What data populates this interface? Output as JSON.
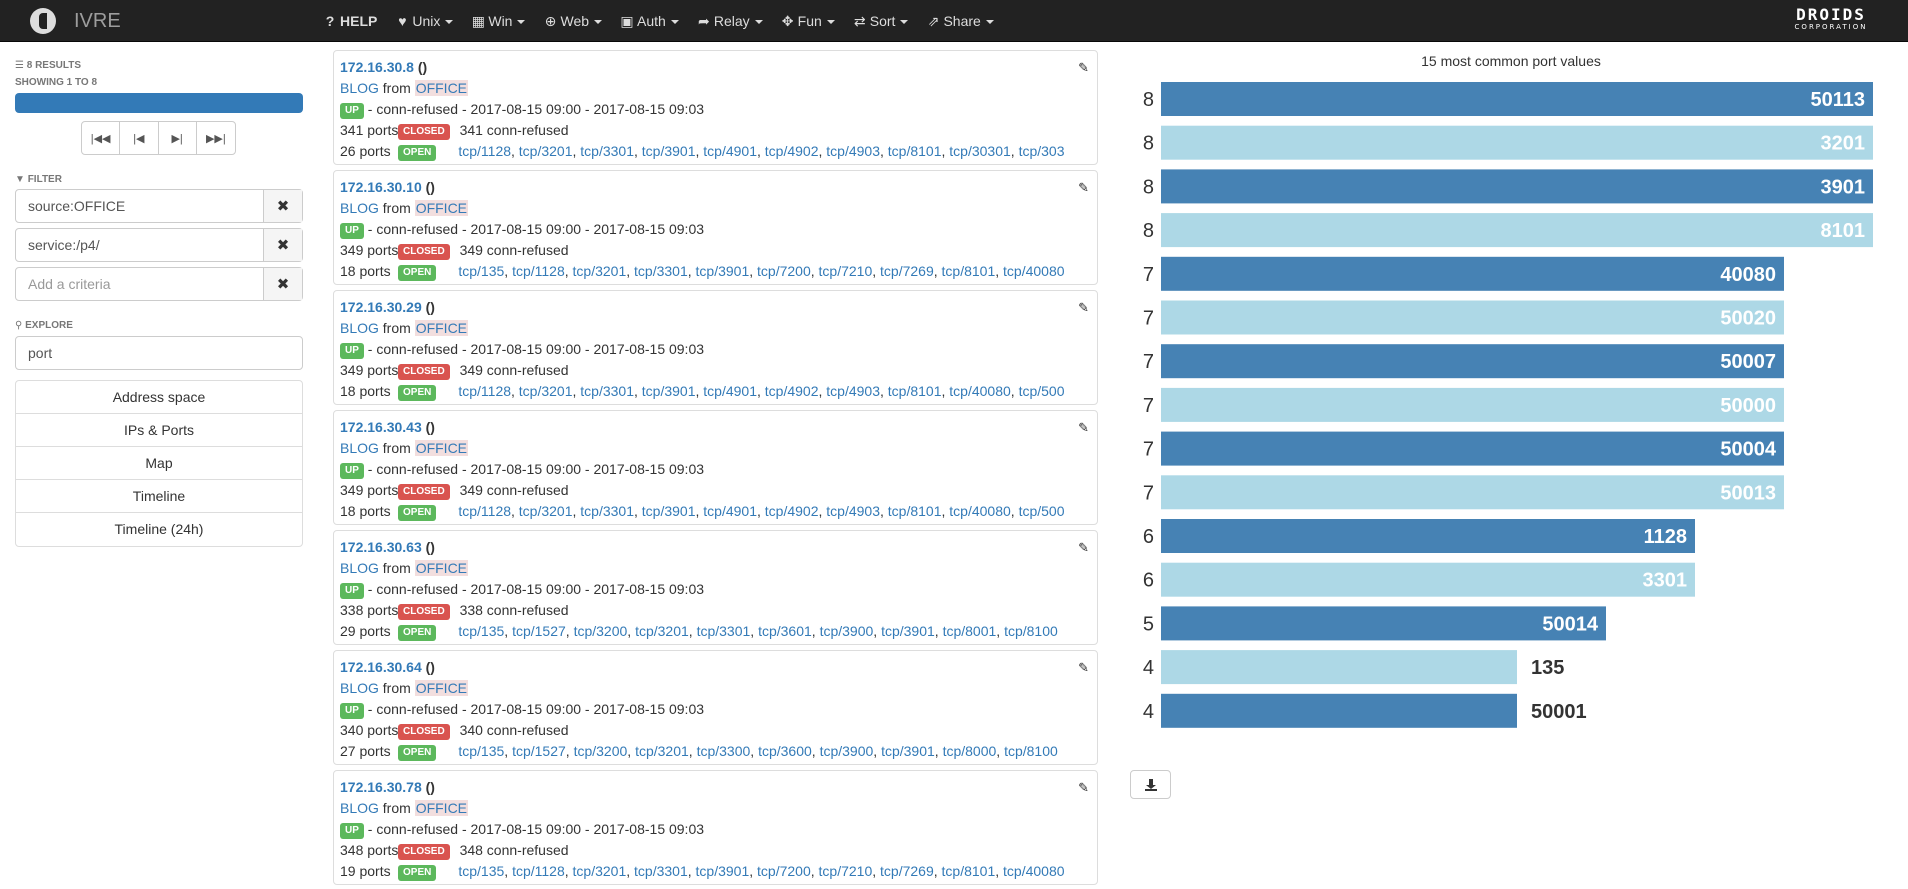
{
  "nav": {
    "brand": "IVRE",
    "items": [
      {
        "icon": "question-circle-icon",
        "glyph": "?",
        "label": "HELP",
        "bold": true,
        "caret": false
      },
      {
        "icon": "heart-icon",
        "glyph": "♥",
        "label": "Unix",
        "caret": true
      },
      {
        "icon": "windows-icon",
        "glyph": "▦",
        "label": "Win",
        "caret": true
      },
      {
        "icon": "globe-icon",
        "glyph": "⊕",
        "label": "Web",
        "caret": true
      },
      {
        "icon": "lock-icon",
        "glyph": "▣",
        "label": "Auth",
        "caret": true
      },
      {
        "icon": "share-arrow-icon",
        "glyph": "➦",
        "label": "Relay",
        "caret": true
      },
      {
        "icon": "move-icon",
        "glyph": "✥",
        "label": "Fun",
        "caret": true
      },
      {
        "icon": "random-icon",
        "glyph": "⇄",
        "label": "Sort",
        "caret": true
      },
      {
        "icon": "external-link-icon",
        "glyph": "⇗",
        "label": "Share",
        "caret": true
      }
    ],
    "corp_line1": "DROIDS",
    "corp_line2": "CORPORATION"
  },
  "sidebar": {
    "results_label": "8 RESULTS",
    "showing_label": "SHOWING 1 TO 8",
    "progress": 1.0,
    "filter_label": "FILTER",
    "criteria": [
      "source:OFFICE",
      "service:/p4/"
    ],
    "add_placeholder": "Add a criteria",
    "explore_label": "EXPLORE",
    "explore_value": "port",
    "explore_items": [
      "Address space",
      "IPs & Ports",
      "Map",
      "Timeline",
      "Timeline (24h)"
    ]
  },
  "hosts": [
    {
      "ip": "172.16.30.8",
      "paren": "()",
      "source": "BLOG",
      "from": "from",
      "category": "OFFICE",
      "up": "UP",
      "status_text": "- conn-refused - 2017-08-15 09:00 - 2017-08-15 09:03",
      "closed_count": "341 ports",
      "closed_label": "CLOSED",
      "closed_reason": "341 conn-refused",
      "open_count": "26 ports",
      "open_label": "OPEN",
      "ports": [
        "tcp/1128",
        "tcp/3201",
        "tcp/3301",
        "tcp/3901",
        "tcp/4901",
        "tcp/4902",
        "tcp/4903",
        "tcp/8101",
        "tcp/30301",
        "tcp/303"
      ]
    },
    {
      "ip": "172.16.30.10",
      "paren": "()",
      "source": "BLOG",
      "from": "from",
      "category": "OFFICE",
      "up": "UP",
      "status_text": "- conn-refused - 2017-08-15 09:00 - 2017-08-15 09:03",
      "closed_count": "349 ports",
      "closed_label": "CLOSED",
      "closed_reason": "349 conn-refused",
      "open_count": "18 ports",
      "open_label": "OPEN",
      "ports": [
        "tcp/135",
        "tcp/1128",
        "tcp/3201",
        "tcp/3301",
        "tcp/3901",
        "tcp/7200",
        "tcp/7210",
        "tcp/7269",
        "tcp/8101",
        "tcp/40080"
      ]
    },
    {
      "ip": "172.16.30.29",
      "paren": "()",
      "source": "BLOG",
      "from": "from",
      "category": "OFFICE",
      "up": "UP",
      "status_text": "- conn-refused - 2017-08-15 09:00 - 2017-08-15 09:03",
      "closed_count": "349 ports",
      "closed_label": "CLOSED",
      "closed_reason": "349 conn-refused",
      "open_count": "18 ports",
      "open_label": "OPEN",
      "ports": [
        "tcp/1128",
        "tcp/3201",
        "tcp/3301",
        "tcp/3901",
        "tcp/4901",
        "tcp/4902",
        "tcp/4903",
        "tcp/8101",
        "tcp/40080",
        "tcp/500"
      ]
    },
    {
      "ip": "172.16.30.43",
      "paren": "()",
      "source": "BLOG",
      "from": "from",
      "category": "OFFICE",
      "up": "UP",
      "status_text": "- conn-refused - 2017-08-15 09:00 - 2017-08-15 09:03",
      "closed_count": "349 ports",
      "closed_label": "CLOSED",
      "closed_reason": "349 conn-refused",
      "open_count": "18 ports",
      "open_label": "OPEN",
      "ports": [
        "tcp/1128",
        "tcp/3201",
        "tcp/3301",
        "tcp/3901",
        "tcp/4901",
        "tcp/4902",
        "tcp/4903",
        "tcp/8101",
        "tcp/40080",
        "tcp/500"
      ]
    },
    {
      "ip": "172.16.30.63",
      "paren": "()",
      "source": "BLOG",
      "from": "from",
      "category": "OFFICE",
      "up": "UP",
      "status_text": "- conn-refused - 2017-08-15 09:00 - 2017-08-15 09:03",
      "closed_count": "338 ports",
      "closed_label": "CLOSED",
      "closed_reason": "338 conn-refused",
      "open_count": "29 ports",
      "open_label": "OPEN",
      "ports": [
        "tcp/135",
        "tcp/1527",
        "tcp/3200",
        "tcp/3201",
        "tcp/3301",
        "tcp/3601",
        "tcp/3900",
        "tcp/3901",
        "tcp/8001",
        "tcp/8100"
      ]
    },
    {
      "ip": "172.16.30.64",
      "paren": "()",
      "source": "BLOG",
      "from": "from",
      "category": "OFFICE",
      "up": "UP",
      "status_text": "- conn-refused - 2017-08-15 09:00 - 2017-08-15 09:03",
      "closed_count": "340 ports",
      "closed_label": "CLOSED",
      "closed_reason": "340 conn-refused",
      "open_count": "27 ports",
      "open_label": "OPEN",
      "ports": [
        "tcp/135",
        "tcp/1527",
        "tcp/3200",
        "tcp/3201",
        "tcp/3300",
        "tcp/3600",
        "tcp/3900",
        "tcp/3901",
        "tcp/8000",
        "tcp/8100"
      ]
    },
    {
      "ip": "172.16.30.78",
      "paren": "()",
      "source": "BLOG",
      "from": "from",
      "category": "OFFICE",
      "up": "UP",
      "status_text": "- conn-refused - 2017-08-15 09:00 - 2017-08-15 09:03",
      "closed_count": "348 ports",
      "closed_label": "CLOSED",
      "closed_reason": "348 conn-refused",
      "open_count": "19 ports",
      "open_label": "OPEN",
      "ports": [
        "tcp/135",
        "tcp/1128",
        "tcp/3201",
        "tcp/3301",
        "tcp/3901",
        "tcp/7200",
        "tcp/7210",
        "tcp/7269",
        "tcp/8101",
        "tcp/40080"
      ]
    }
  ],
  "chart_data": {
    "type": "bar",
    "title": "15 most common port values",
    "orientation": "horizontal",
    "categories": [
      "50113",
      "3201",
      "3901",
      "8101",
      "40080",
      "50020",
      "50007",
      "50000",
      "50004",
      "50013",
      "1128",
      "3301",
      "50014",
      "135",
      "50001"
    ],
    "values": [
      8,
      8,
      8,
      8,
      7,
      7,
      7,
      7,
      7,
      7,
      6,
      6,
      5,
      4,
      4
    ],
    "xlim": [
      0,
      8
    ],
    "colors": [
      "#4682b4",
      "#add8e6"
    ]
  },
  "download_icon": "download-icon"
}
